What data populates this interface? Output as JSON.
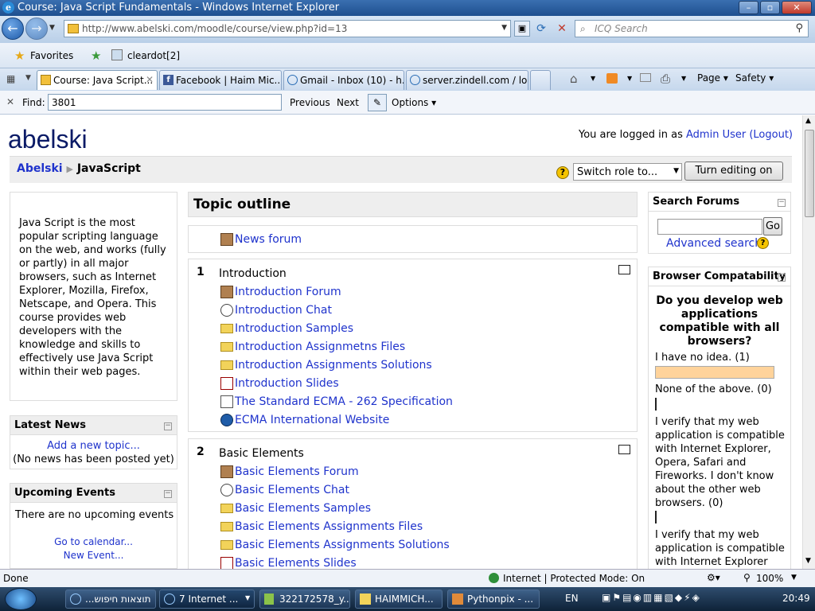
{
  "window": {
    "title": "Course: Java Script Fundamentals - Windows Internet Explorer"
  },
  "address": {
    "url": "http://www.abelski.com/moodle/course/view.php?id=13",
    "search_placeholder": "ICQ Search"
  },
  "favorites": {
    "label": "Favorites",
    "item": "cleardot[2]"
  },
  "tabs": [
    {
      "label": "Course: Java Script..."
    },
    {
      "label": "Facebook | Haim Mic..."
    },
    {
      "label": "Gmail - Inbox (10) - h..."
    },
    {
      "label": "server.zindell.com / lo..."
    }
  ],
  "cmdbar": {
    "page": "Page",
    "safety": "Safety"
  },
  "find": {
    "label": "Find:",
    "value": "3801",
    "previous": "Previous",
    "next": "Next",
    "options": "Options"
  },
  "site": {
    "name": "abelski",
    "login_prefix": "You are logged in as",
    "user": "Admin User",
    "logout": "(Logout)",
    "breadcrumb_home": "Abelski",
    "breadcrumb_sep": "▶",
    "breadcrumb_current": "JavaScript",
    "switch_role": "Switch role to...",
    "turn_editing": "Turn editing on"
  },
  "left": {
    "summary": "Java Script is the most popular scripting language on the web, and works (fully or partly) in all major browsers, such as Internet Explorer, Mozilla, Firefox, Netscape, and Opera. This course provides web developers with the knowledge and skills to effectively use Java Script within their web pages.",
    "news_title": "Latest News",
    "add_topic": "Add a new topic...",
    "no_news": "(No news has been posted yet)",
    "events_title": "Upcoming Events",
    "no_events": "There are no upcoming events",
    "calendar": "Go to calendar...",
    "new_event": "New Event..."
  },
  "center": {
    "title": "Topic outline",
    "news_forum": "News forum",
    "sections": [
      {
        "num": "1",
        "title": "Introduction",
        "items": [
          {
            "icon": "forum-icon",
            "label": "Introduction Forum"
          },
          {
            "icon": "chat-icon",
            "label": "Introduction Chat"
          },
          {
            "icon": "folder-icon",
            "label": "Introduction Samples"
          },
          {
            "icon": "folder-icon",
            "label": "Introduction Assignmetns Files"
          },
          {
            "icon": "folder-icon",
            "label": "Introduction Assignments Solutions"
          },
          {
            "icon": "pdf-icon",
            "label": "Introduction Slides"
          },
          {
            "icon": "page-icon",
            "label": "The Standard ECMA - 262 Specification"
          },
          {
            "icon": "web-icon",
            "label": "ECMA International Website"
          }
        ]
      },
      {
        "num": "2",
        "title": "Basic Elements",
        "items": [
          {
            "icon": "forum-icon",
            "label": "Basic Elements Forum"
          },
          {
            "icon": "chat-icon",
            "label": "Basic Elements Chat"
          },
          {
            "icon": "folder-icon",
            "label": "Basic Elements Samples"
          },
          {
            "icon": "folder-icon",
            "label": "Basic Elements Assignments Files"
          },
          {
            "icon": "folder-icon",
            "label": "Basic Elements Assignments Solutions"
          },
          {
            "icon": "pdf-icon",
            "label": "Basic Elements Slides"
          }
        ]
      }
    ]
  },
  "right": {
    "search_title": "Search Forums",
    "go": "Go",
    "advanced": "Advanced search",
    "poll_title": "Browser Compatability",
    "question": "Do you develop web applications compatible with all browsers?",
    "options": [
      {
        "text": "I have no idea. (1)",
        "fraction": 1.0
      },
      {
        "text": "None of the above. (0)",
        "fraction": 0.0
      },
      {
        "text": "I verify that my web application is compatible with Internet Explorer, Opera, Safari and Fireworks. I don't know about the other web browsers. (0)",
        "fraction": 0.0
      },
      {
        "text": "I verify that my web application is compatible with Internet Explorer",
        "fraction": null
      }
    ]
  },
  "status": {
    "left": "Done",
    "zone": "Internet | Protected Mode: On",
    "zoom": "100%"
  },
  "taskbar": {
    "items": [
      "תוצאות חיפוש...",
      "7 Internet ...",
      "322172578_y...",
      "HAIMMICH...",
      "Pythonpix - ..."
    ],
    "lang": "EN",
    "time": "20:49"
  }
}
